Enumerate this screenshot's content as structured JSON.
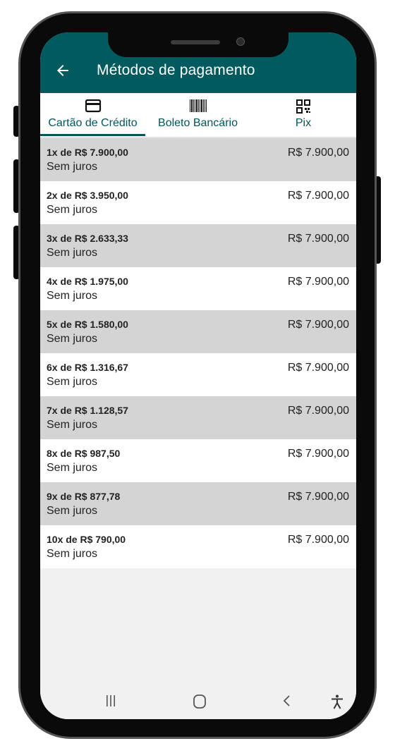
{
  "appbar": {
    "title": "Métodos de pagamento",
    "back_icon": "arrow-left-icon"
  },
  "tabs": [
    {
      "label": "Cartão de Crédito",
      "icon": "credit-card-icon",
      "selected": true
    },
    {
      "label": "Boleto Bancário",
      "icon": "barcode-icon",
      "selected": false
    },
    {
      "label": "Pix",
      "icon": "qr-code-icon",
      "selected": false
    }
  ],
  "installments": [
    {
      "installment": "1x de R$ 7.900,00",
      "interest": "Sem juros",
      "total": "R$ 7.900,00"
    },
    {
      "installment": "2x de R$ 3.950,00",
      "interest": "Sem juros",
      "total": "R$ 7.900,00"
    },
    {
      "installment": "3x de R$ 2.633,33",
      "interest": "Sem juros",
      "total": "R$ 7.900,00"
    },
    {
      "installment": "4x de R$ 1.975,00",
      "interest": "Sem juros",
      "total": "R$ 7.900,00"
    },
    {
      "installment": "5x de R$ 1.580,00",
      "interest": "Sem juros",
      "total": "R$ 7.900,00"
    },
    {
      "installment": "6x de R$ 1.316,67",
      "interest": "Sem juros",
      "total": "R$ 7.900,00"
    },
    {
      "installment": "7x de R$ 1.128,57",
      "interest": "Sem juros",
      "total": "R$ 7.900,00"
    },
    {
      "installment": "8x de R$ 987,50",
      "interest": "Sem juros",
      "total": "R$ 7.900,00"
    },
    {
      "installment": "9x de R$ 877,78",
      "interest": "Sem juros",
      "total": "R$ 7.900,00"
    },
    {
      "installment": "10x de R$ 790,00",
      "interest": "Sem juros",
      "total": "R$ 7.900,00"
    }
  ],
  "navbar": {
    "recents_icon": "recents-icon",
    "home_icon": "home-icon",
    "back_icon": "nav-back-icon",
    "accessibility_icon": "accessibility-icon"
  },
  "colors": {
    "primary": "#005a5e",
    "tab_active": "#00565a",
    "row_shaded": "#d4d4d4",
    "row_plain": "#ffffff",
    "background": "#f1f1f1"
  }
}
